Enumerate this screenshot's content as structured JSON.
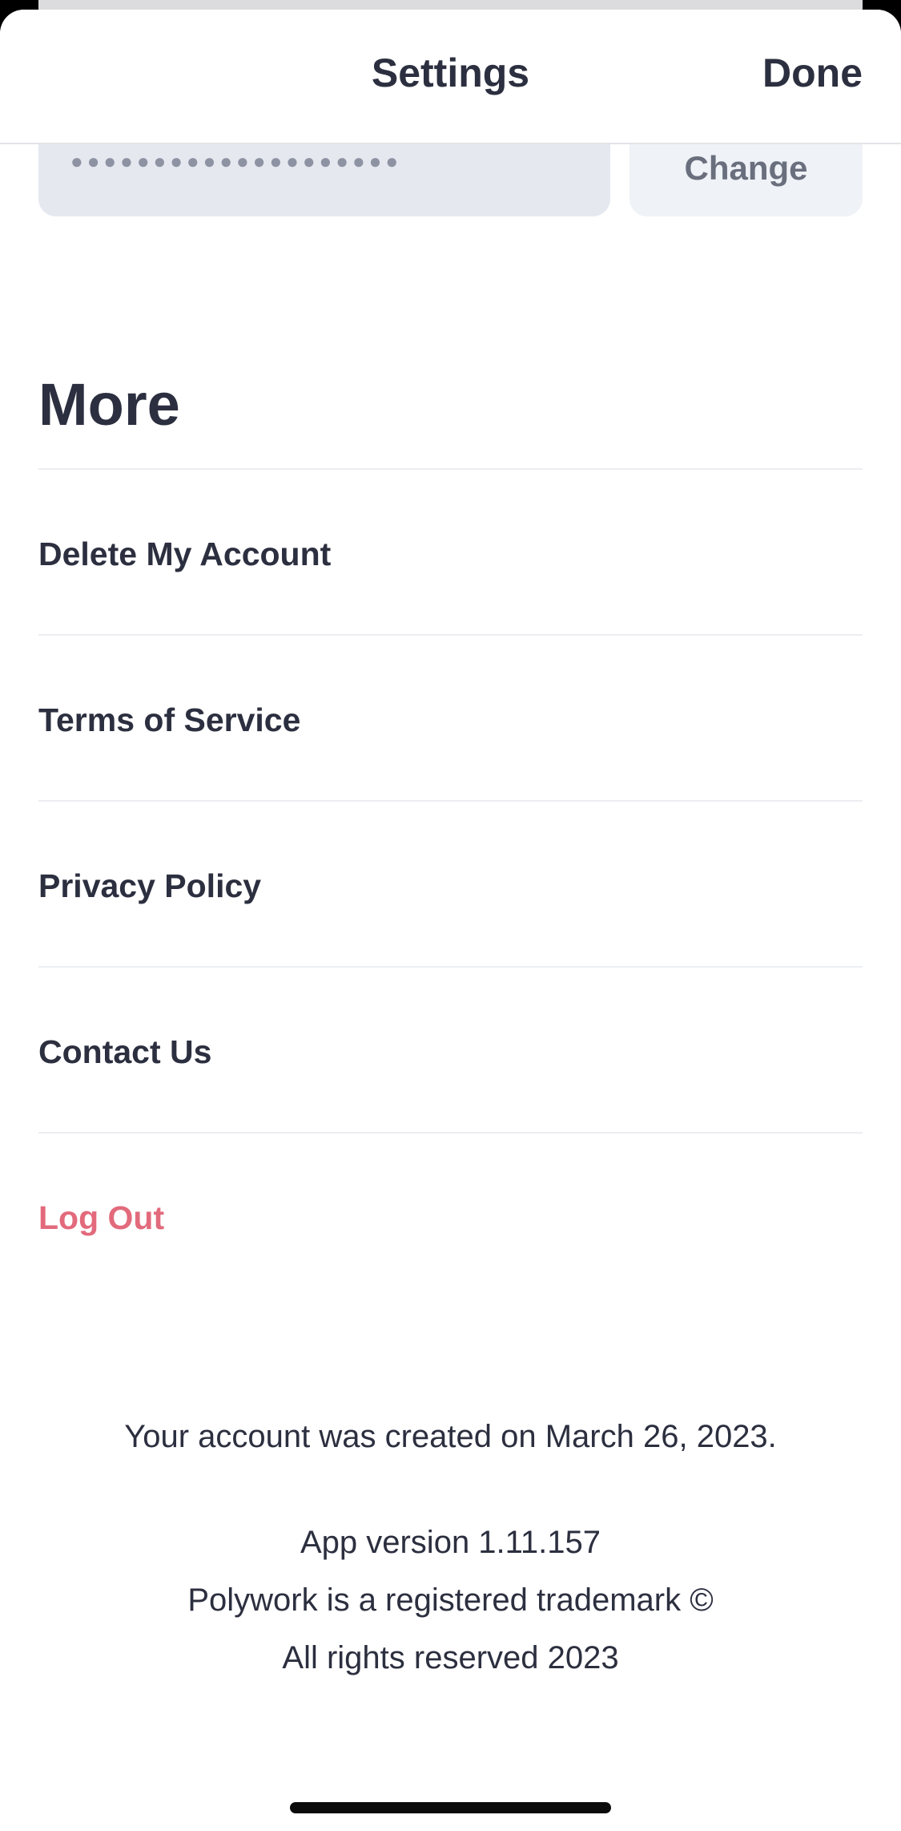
{
  "header": {
    "title": "Settings",
    "done_label": "Done"
  },
  "password": {
    "masked_value": "●●●●●●●●●●●●●●●●●●●●",
    "change_label": "Change"
  },
  "more": {
    "section_title": "More",
    "items": [
      {
        "label": "Delete My Account"
      },
      {
        "label": "Terms of Service"
      },
      {
        "label": "Privacy Policy"
      },
      {
        "label": "Contact Us"
      },
      {
        "label": "Log Out"
      }
    ]
  },
  "footer": {
    "created": "Your account was created on March 26, 2023.",
    "version": "App version 1.11.157",
    "trademark": "Polywork is a registered trademark ©",
    "rights": "All rights reserved 2023"
  },
  "colors": {
    "text": "#2c2f3f",
    "danger": "#e26a7c",
    "field_bg": "#e6e8f0",
    "button_bg": "#eff2f6"
  }
}
